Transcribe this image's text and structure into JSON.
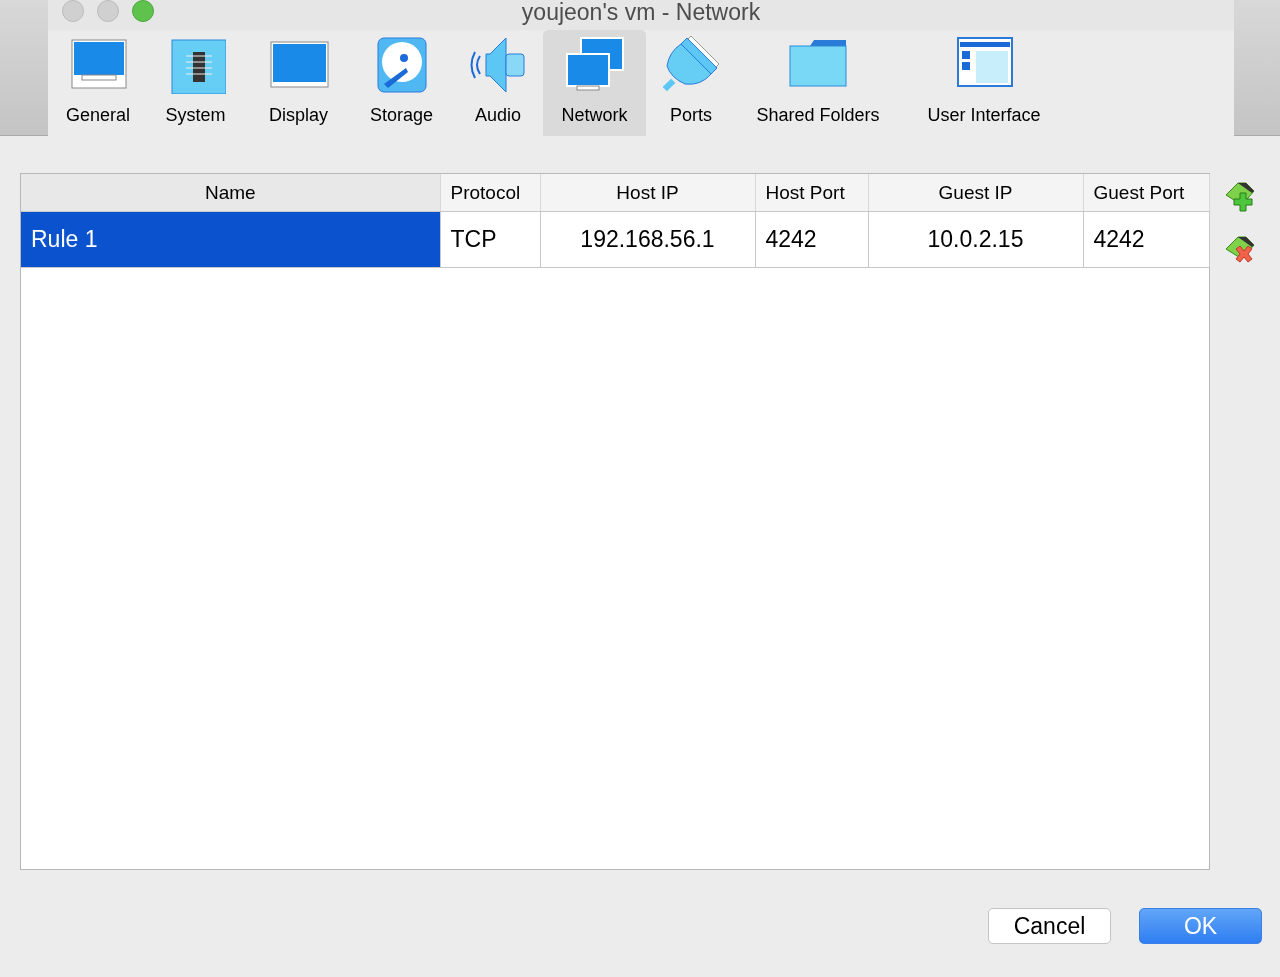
{
  "window": {
    "title": "youjeon's vm - Network"
  },
  "toolbar": {
    "items": [
      {
        "label": "General",
        "selected": false
      },
      {
        "label": "System",
        "selected": false
      },
      {
        "label": "Display",
        "selected": false
      },
      {
        "label": "Storage",
        "selected": false
      },
      {
        "label": "Audio",
        "selected": false
      },
      {
        "label": "Network",
        "selected": true
      },
      {
        "label": "Ports",
        "selected": false
      },
      {
        "label": "Shared Folders",
        "selected": false
      },
      {
        "label": "User Interface",
        "selected": false
      }
    ]
  },
  "table": {
    "columns": [
      "Name",
      "Protocol",
      "Host IP",
      "Host Port",
      "Guest IP",
      "Guest Port"
    ],
    "rows": [
      {
        "cells": [
          "Rule 1",
          "TCP",
          "192.168.56.1",
          "4242",
          "10.0.2.15",
          "4242"
        ],
        "selected": true
      }
    ]
  },
  "buttons": [
    {
      "label": "Cancel",
      "kind": "plain"
    },
    {
      "label": "OK",
      "kind": "primary"
    }
  ]
}
